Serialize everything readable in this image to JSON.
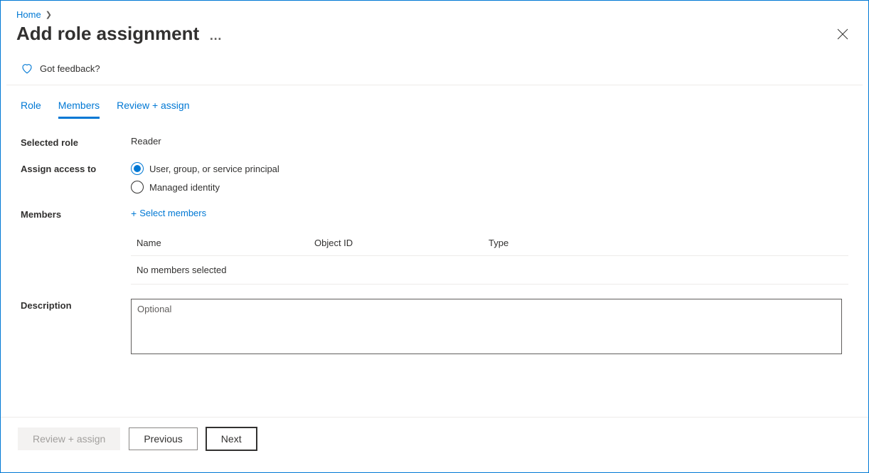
{
  "breadcrumb": {
    "home": "Home"
  },
  "header": {
    "title": "Add role assignment"
  },
  "feedback": {
    "label": "Got feedback?"
  },
  "tabs": {
    "role": "Role",
    "members": "Members",
    "review": "Review + assign",
    "active": "members"
  },
  "form": {
    "selected_role_label": "Selected role",
    "selected_role_value": "Reader",
    "assign_access_label": "Assign access to",
    "assign_options": {
      "user_group": "User, group, or service principal",
      "managed_identity": "Managed identity",
      "selected": "user_group"
    },
    "members_label": "Members",
    "select_members_link": "Select members",
    "table": {
      "col_name": "Name",
      "col_object_id": "Object ID",
      "col_type": "Type",
      "empty": "No members selected"
    },
    "description_label": "Description",
    "description_placeholder": "Optional",
    "description_value": ""
  },
  "footer": {
    "review_assign": "Review + assign",
    "previous": "Previous",
    "next": "Next"
  }
}
